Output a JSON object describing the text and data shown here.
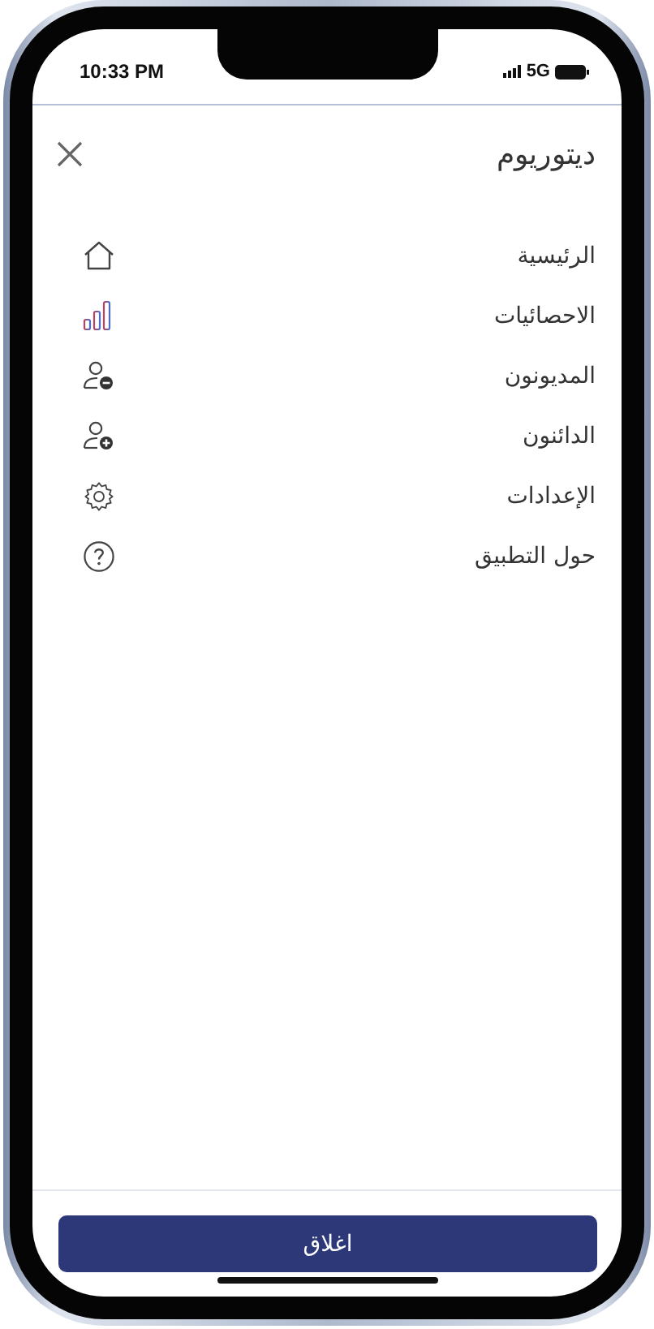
{
  "status_bar": {
    "time": "10:33 PM",
    "network": "5G"
  },
  "header": {
    "title": "ديتوريوم"
  },
  "menu": [
    {
      "label": "الرئيسية",
      "kind": "home"
    },
    {
      "label": "الاحصائيات",
      "kind": "stats"
    },
    {
      "label": "المديونون",
      "kind": "user-minus"
    },
    {
      "label": "الدائنون",
      "kind": "user-plus"
    },
    {
      "label": "الإعدادات",
      "kind": "settings"
    },
    {
      "label": "حول التطبيق",
      "kind": "help"
    }
  ],
  "footer": {
    "button": "اغلاق"
  }
}
